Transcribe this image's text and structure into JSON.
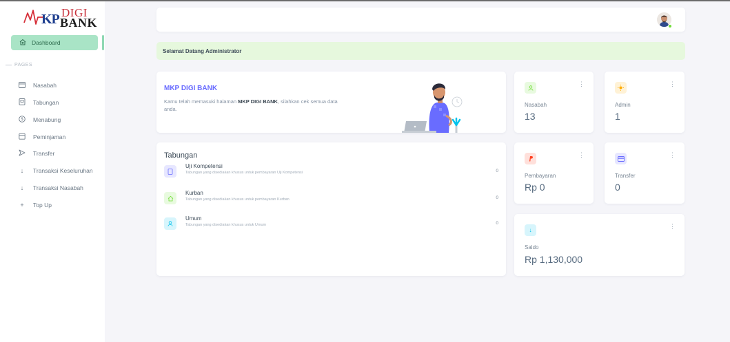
{
  "brand": {
    "logo_kp": "KP",
    "logo_digi": "DIGI",
    "logo_bank": "BANK"
  },
  "sidebar": {
    "active": {
      "label": "Dashboard",
      "icon": "home-icon"
    },
    "section_label": "PAGES",
    "items": [
      {
        "label": "Nasabah",
        "icon": "user-card-icon"
      },
      {
        "label": "Tabungan",
        "icon": "book-icon"
      },
      {
        "label": "Menabung",
        "icon": "dollar-circle-icon"
      },
      {
        "label": "Peminjaman",
        "icon": "calendar-icon"
      },
      {
        "label": "Transfer",
        "icon": "send-icon"
      },
      {
        "label": "Transaksi Keseluruhan",
        "icon": "arrow-down-icon"
      },
      {
        "label": "Transaksi Nasabah",
        "icon": "arrow-down-icon"
      },
      {
        "label": "Top Up",
        "icon": "plus-icon"
      }
    ]
  },
  "welcome": {
    "text": "Selamat Datang Administrator"
  },
  "intro": {
    "title": "MKP DIGI BANK",
    "desc_prefix": "Kamu telah memasuki halaman ",
    "desc_bold": "MKP DIGI BANK",
    "desc_suffix": ", silahkan cek semua data anda."
  },
  "stats": {
    "nasabah": {
      "label": "Nasabah",
      "value": "13",
      "icon": "user-icon",
      "color": "#71dd37"
    },
    "admin": {
      "label": "Admin",
      "value": "1",
      "icon": "sun-icon",
      "color": "#ffab00"
    },
    "pembayaran": {
      "label": "Pembayaran",
      "value": "Rp 0",
      "icon": "paypal-icon",
      "color": "#ff3e1d"
    },
    "transfer": {
      "label": "Transfer",
      "value": "0",
      "icon": "credit-card-icon",
      "color": "#696cff"
    },
    "saldo": {
      "label": "Saldo",
      "value": "Rp 1,130,000",
      "icon": "arrow-down-icon",
      "color": "#03c3ec"
    }
  },
  "tabungan": {
    "title": "Tabungan",
    "items": [
      {
        "name": "Uji Kompetensi",
        "desc": "Tabungan yang disediakan khusus untuk pembayaran Uji Kompetensi",
        "amount": "0",
        "icon": "document-icon",
        "color": "#696cff"
      },
      {
        "name": "Kurban",
        "desc": "Tabungan yang disediakan khusus untuk pembayaran Kurban",
        "amount": "0",
        "icon": "home-icon",
        "color": "#71dd37"
      },
      {
        "name": "Umum",
        "desc": "Tabungan yang disediakan khusus untuk Umum",
        "amount": "0",
        "icon": "user-icon",
        "color": "#03c3ec"
      }
    ]
  }
}
